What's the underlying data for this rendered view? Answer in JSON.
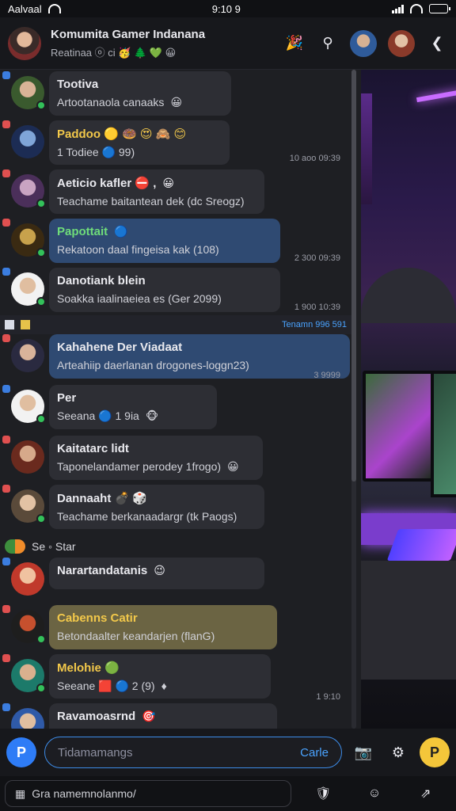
{
  "status": {
    "carrier": "Aalvaal",
    "time": "9:10 9"
  },
  "header": {
    "title": "Komumita Gamer Indanana",
    "subtitle": "Reatinaa ⓞ ci 🥳 🌲 💚 😀",
    "extra_emoji": "🎉"
  },
  "chats": [
    {
      "name": "Tootiva",
      "snippet": "Artootanaola canaaks",
      "emoji": "😀",
      "time": "",
      "bubble_color": "#2d2e34",
      "name_color": "#e9e9ee"
    },
    {
      "name": "Paddoo 🟡 🍩 😍 🙈 😊",
      "snippet": "1 Todiee 🔵 99)",
      "emoji": "",
      "time": "10 aoo 09:39",
      "bubble_color": "#2d2e34",
      "name_color": "#f2c84a"
    },
    {
      "name": "Aeticio kafler ⛔ ,",
      "snippet": "Teachame baitantean dek (dc Sreogz)",
      "emoji": "😀",
      "time": "",
      "bubble_color": "#2d2e34",
      "name_color": "#e9e9ee"
    },
    {
      "name": "Papottait",
      "snippet": "Rekatoon daal fingeisa kak (108)",
      "emoji": "🔵",
      "time": "2 300 09:39",
      "bubble_color": "#2f4a72",
      "name_color": "#6fdc7a"
    },
    {
      "name": "Danotiank blein",
      "snippet": "Soakka iaalinaeiea es (Ger 2099)",
      "emoji": "",
      "time": "1 900 10:39",
      "bubble_color": "#2d2e34",
      "name_color": "#e9e9ee"
    },
    {
      "name": "Kahahene Der Viadaat",
      "snippet": "Arteahiip daerlanan drogones-loggn23)",
      "emoji": "",
      "time": "3 9999",
      "bubble_color": "#2f4a72",
      "name_color": "#e9e9ee"
    },
    {
      "name": "Per",
      "snippet": "Seeana 🔵 1 9ia",
      "emoji": "🐵",
      "time": "",
      "bubble_color": "#2d2e34",
      "name_color": "#e9e9ee"
    },
    {
      "name": "Kaitatarc lidt",
      "snippet": "Taponelandamer perodey 1frogo)",
      "emoji": "😀",
      "time": "",
      "bubble_color": "#2d2e34",
      "name_color": "#e9e9ee"
    },
    {
      "name": "Dannaaht 💣 🎲",
      "snippet": "Teachame berkanaadargr (tk Paogs)",
      "emoji": "",
      "time": "",
      "bubble_color": "#2d2e34",
      "name_color": "#e9e9ee"
    },
    {
      "name": "Narartandatanis",
      "snippet": "",
      "emoji": "😉",
      "time": "",
      "bubble_color": "#2d2e34",
      "name_color": "#e9e9ee"
    },
    {
      "name": "Cabenns Catir",
      "snippet": "Betondaalter keandarjen (flanG)",
      "emoji": "",
      "time": "",
      "bubble_color": "#6b6443",
      "name_color": "#f2c84a"
    },
    {
      "name": "Melohie 🟢",
      "snippet": "Seeane 🟥 🔵 2 (9)",
      "emoji": "♦",
      "time": "1 9:10",
      "bubble_color": "#2d2e34",
      "name_color": "#f2c84a"
    },
    {
      "name": "Ravamoasrnd",
      "snippet": "",
      "emoji": "🎯",
      "time": "",
      "bubble_color": "#2d2e34",
      "name_color": "#e9e9ee"
    }
  ],
  "divider": {
    "text": "Tenamn 996 591"
  },
  "mini_row": {
    "text": "Se ◦ Star"
  },
  "composer": {
    "placeholder": "Tidamamangs",
    "send_label": "Carle"
  },
  "bottom": {
    "search_text": "Gra namemnolanmo/"
  }
}
